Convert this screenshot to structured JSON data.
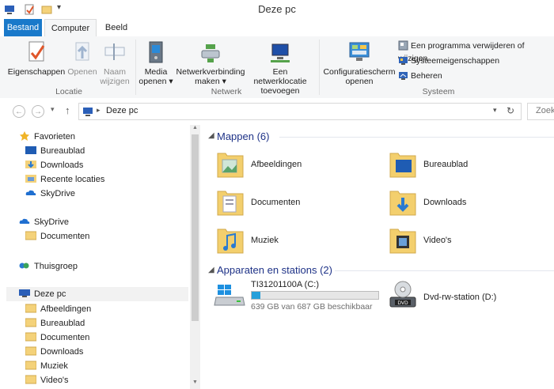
{
  "window": {
    "title": "Deze pc"
  },
  "tabs": [
    {
      "label": "Bestand"
    },
    {
      "label": "Computer"
    },
    {
      "label": "Beeld"
    }
  ],
  "ribbon": {
    "locatie": {
      "label": "Locatie",
      "buttons": [
        {
          "label": "Eigenschappen"
        },
        {
          "label": "Openen"
        },
        {
          "label_line1": "Naam",
          "label_line2": "wijzigen"
        }
      ]
    },
    "netwerk": {
      "label": "Netwerk",
      "buttons": [
        {
          "label_line1": "Media",
          "label_line2": "openen"
        },
        {
          "label_line1": "Netwerkverbinding",
          "label_line2": "maken"
        },
        {
          "label_line1": "Een netwerklocatie",
          "label_line2": "toevoegen"
        }
      ]
    },
    "systeem": {
      "label": "Systeem",
      "config_line1": "Configuratiescherm",
      "config_line2": "openen",
      "links": [
        {
          "label": "Een programma verwijderen of wijzigen"
        },
        {
          "label": "Systeemeigenschappen"
        },
        {
          "label": "Beheren"
        }
      ]
    }
  },
  "address": {
    "crumb": "Deze pc",
    "search_placeholder": "Zoek"
  },
  "nav": {
    "favorites_header": "Favorieten",
    "favorites": [
      "Bureaublad",
      "Downloads",
      "Recente locaties",
      "SkyDrive"
    ],
    "skydrive_header": "SkyDrive",
    "skydrive_items": [
      "Documenten"
    ],
    "homegroup": "Thuisgroep",
    "thispc_header": "Deze pc",
    "thispc_items": [
      "Afbeeldingen",
      "Bureaublad",
      "Documenten",
      "Downloads",
      "Muziek",
      "Video's"
    ]
  },
  "content": {
    "folders_header": "Mappen (6)",
    "folders": [
      "Afbeeldingen",
      "Bureaublad",
      "Documenten",
      "Downloads",
      "Muziek",
      "Video's"
    ],
    "devices_header": "Apparaten en stations (2)",
    "drive_c": {
      "name": "TI31201100A (C:)",
      "space": "639 GB van 687 GB beschikbaar",
      "used_fraction": 0.07
    },
    "dvd": {
      "name": "Dvd-rw-station (D:)"
    }
  },
  "colors": {
    "accent": "#1979ca",
    "section_header": "#1e3287",
    "progress": "#26a0da"
  }
}
